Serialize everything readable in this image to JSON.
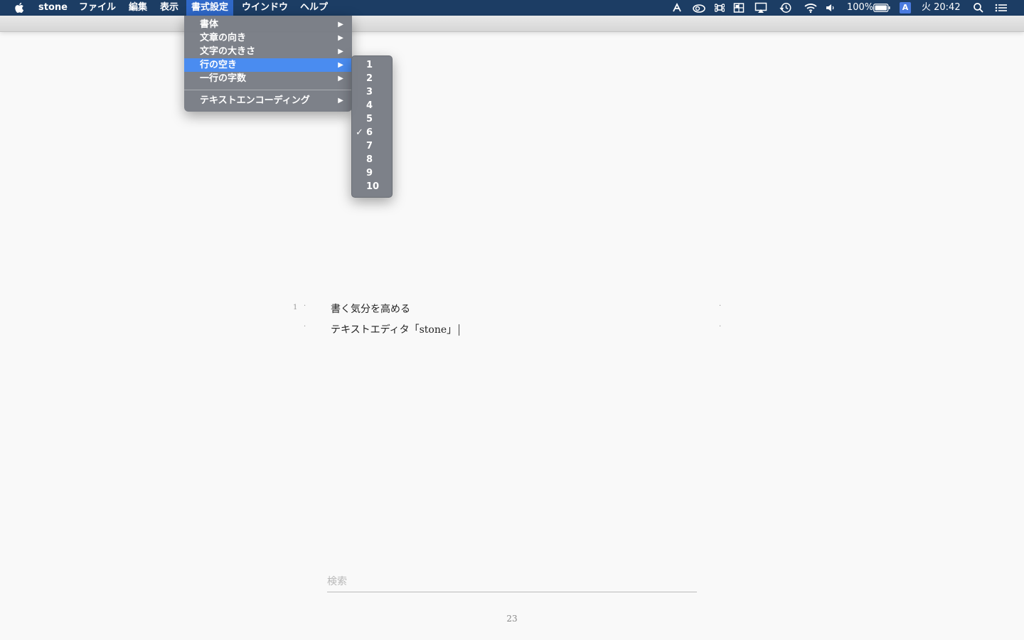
{
  "menubar": {
    "app_name": "stone",
    "menus": [
      "ファイル",
      "編集",
      "表示",
      "書式設定",
      "ウインドウ",
      "ヘルプ"
    ],
    "active_menu": "書式設定",
    "status": {
      "icons": [
        "script-icon",
        "creative-cloud-icon",
        "command-icon",
        "display-icon",
        "airplay-icon",
        "time-machine-icon",
        "wifi-icon",
        "volume-icon",
        "battery-icon",
        "input-source-icon",
        "spotlight-icon",
        "notification-center-icon"
      ],
      "battery_percent": "100%",
      "input_source": "A",
      "clock": "火 20:42"
    }
  },
  "format_menu": {
    "items": [
      {
        "label": "書体"
      },
      {
        "label": "文章の向き"
      },
      {
        "label": "文字の大きさ"
      },
      {
        "label": "行の空き"
      },
      {
        "label": "一行の字数"
      },
      {
        "label": "テキストエンコーディング"
      }
    ],
    "highlighted": "行の空き"
  },
  "line_spacing_submenu": {
    "options": [
      "1",
      "2",
      "3",
      "4",
      "5",
      "6",
      "7",
      "8",
      "9",
      "10"
    ],
    "selected": "6"
  },
  "document": {
    "line_number": "1",
    "lines": [
      "書く気分を高める",
      "テキストエディタ「stone」"
    ]
  },
  "search": {
    "placeholder": "検索"
  },
  "page_number": "23",
  "colors": {
    "menubar_bg": "#1c3d64",
    "menu_highlight": "#4a8cf0",
    "menu_bg": "#787c84",
    "page_bg": "#f9f9f9"
  }
}
